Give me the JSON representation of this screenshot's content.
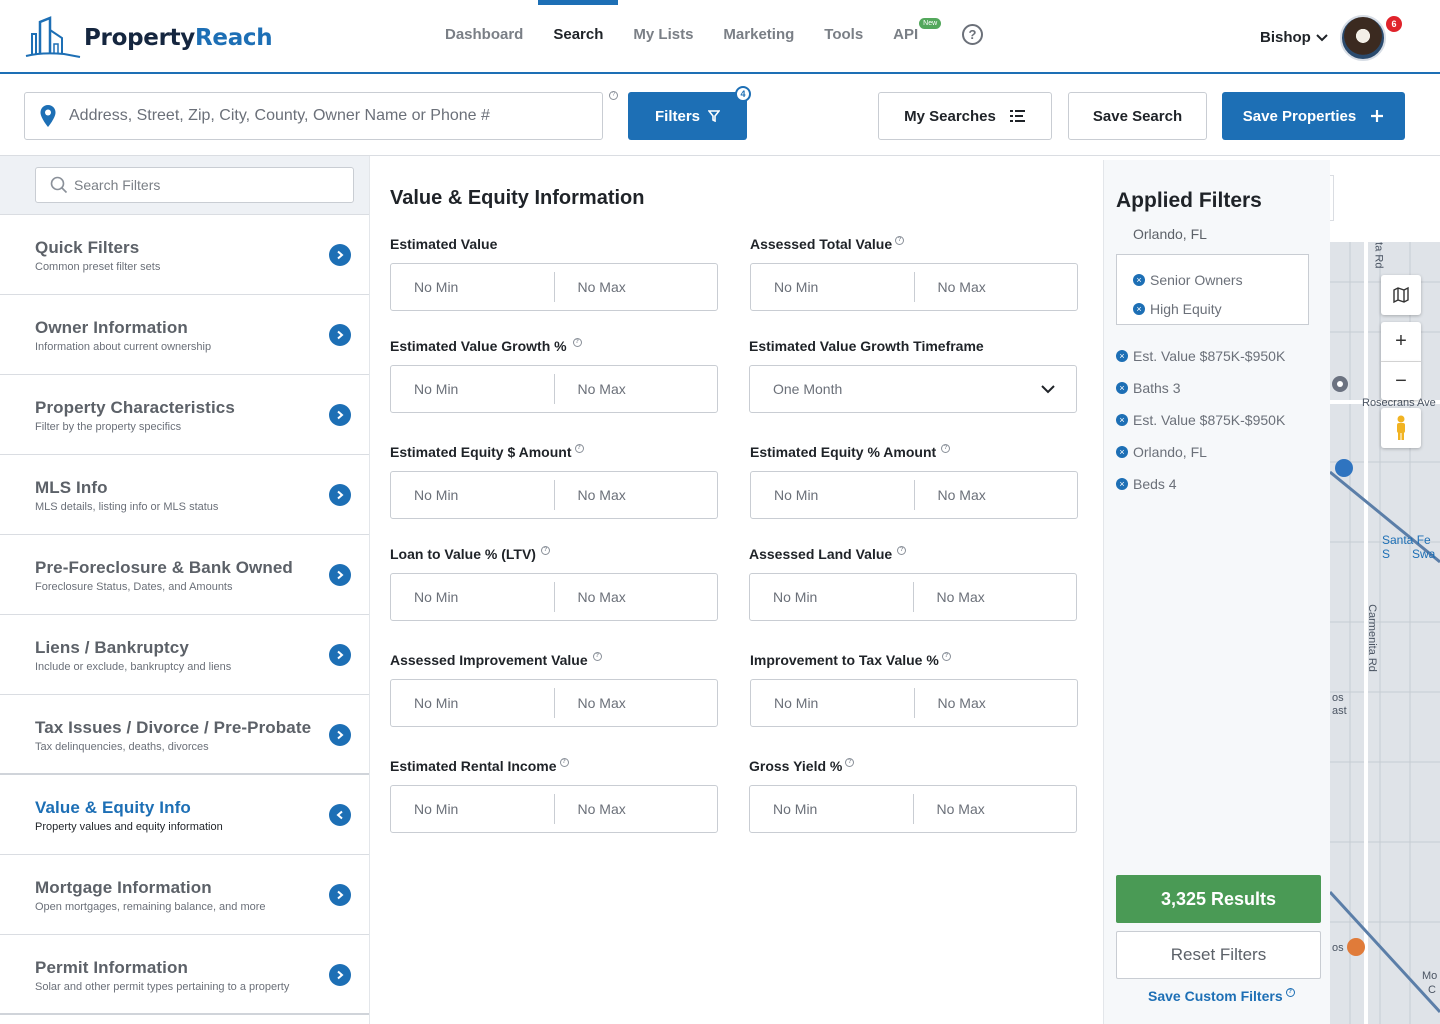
{
  "brand": {
    "name_part1": "Property",
    "name_part2": "Reach"
  },
  "nav": {
    "items": [
      {
        "label": "Dashboard",
        "active": false
      },
      {
        "label": "Search",
        "active": true
      },
      {
        "label": "My Lists",
        "active": false
      },
      {
        "label": "Marketing",
        "active": false
      },
      {
        "label": "Tools",
        "active": false
      },
      {
        "label": "API",
        "active": false,
        "badge": "New"
      }
    ],
    "help_icon": "?",
    "user_name": "Bishop",
    "notification_count": "6"
  },
  "search": {
    "placeholder": "Address, Street, Zip, City, County, Owner Name or Phone #",
    "filters_label": "Filters",
    "filters_count": "4",
    "my_searches_label": "My Searches",
    "save_search_label": "Save Search",
    "save_properties_label": "Save Properties"
  },
  "sidebar": {
    "search_placeholder": "Search Filters",
    "categories": [
      {
        "title": "Quick Filters",
        "sub": "Common preset filter sets"
      },
      {
        "title": "Owner Information",
        "sub": "Information about current ownership"
      },
      {
        "title": "Property Characteristics",
        "sub": "Filter by the property specifics"
      },
      {
        "title": "MLS Info",
        "sub": "MLS details, listing info or MLS status"
      },
      {
        "title": "Pre-Foreclosure & Bank Owned",
        "sub": "Foreclosure Status, Dates, and Amounts"
      },
      {
        "title": "Liens / Bankruptcy",
        "sub": "Include or exclude, bankruptcy and liens"
      },
      {
        "title": "Tax Issues / Divorce / Pre-Probate",
        "sub": "Tax delinquencies, deaths, divorces"
      },
      {
        "title": "Value & Equity Info",
        "sub": "Property values and equity information",
        "active": true
      },
      {
        "title": "Mortgage Information",
        "sub": "Open mortgages, remaining balance, and more"
      },
      {
        "title": "Permit Information",
        "sub": "Solar and other permit types pertaining to a property"
      }
    ]
  },
  "main": {
    "title": "Value & Equity Information",
    "min_label": "No Min",
    "max_label": "No Max",
    "fields": [
      {
        "label": "Estimated Value",
        "info": false
      },
      {
        "label": "Assessed Total Value",
        "info": true
      },
      {
        "label": "Estimated Value Growth %",
        "info": true
      },
      {
        "label": "Estimated Value Growth Timeframe",
        "info": false,
        "select_value": "One Month"
      },
      {
        "label": "Estimated Equity $ Amount",
        "info": true
      },
      {
        "label": "Estimated Equity % Amount",
        "info": true
      },
      {
        "label": "Loan to Value % (LTV)",
        "info": true
      },
      {
        "label": "Assessed Land Value",
        "info": true
      },
      {
        "label": "Assessed Improvement Value",
        "info": true
      },
      {
        "label": "Improvement to Tax Value %",
        "info": true
      },
      {
        "label": "Estimated Rental Income",
        "info": true
      },
      {
        "label": "Gross Yield %",
        "info": true
      }
    ]
  },
  "applied": {
    "title": "Applied Filters",
    "location": "Orlando, FL",
    "boxed_chips": [
      "Senior Owners",
      "High Equity"
    ],
    "chips": [
      "Est. Value $875K-$950K",
      "Baths 3",
      "Est. Value $875K-$950K",
      "Orlando, FL",
      "Beds 4"
    ],
    "results_label": "3,325 Results",
    "reset_label": "Reset Filters",
    "custom_label": "Save Custom Filters"
  },
  "map": {
    "labels": [
      "enita Rd",
      "Rosecrans Ave",
      "Santa Fe S",
      "Swa",
      "Carmenita Rd",
      "os",
      "ast",
      "os",
      "Mo",
      "C"
    ],
    "zoom_in": "+",
    "zoom_out": "−"
  },
  "colors": {
    "accent": "#1d6fb5",
    "success": "#4a9a55",
    "notification": "#e0232b"
  }
}
